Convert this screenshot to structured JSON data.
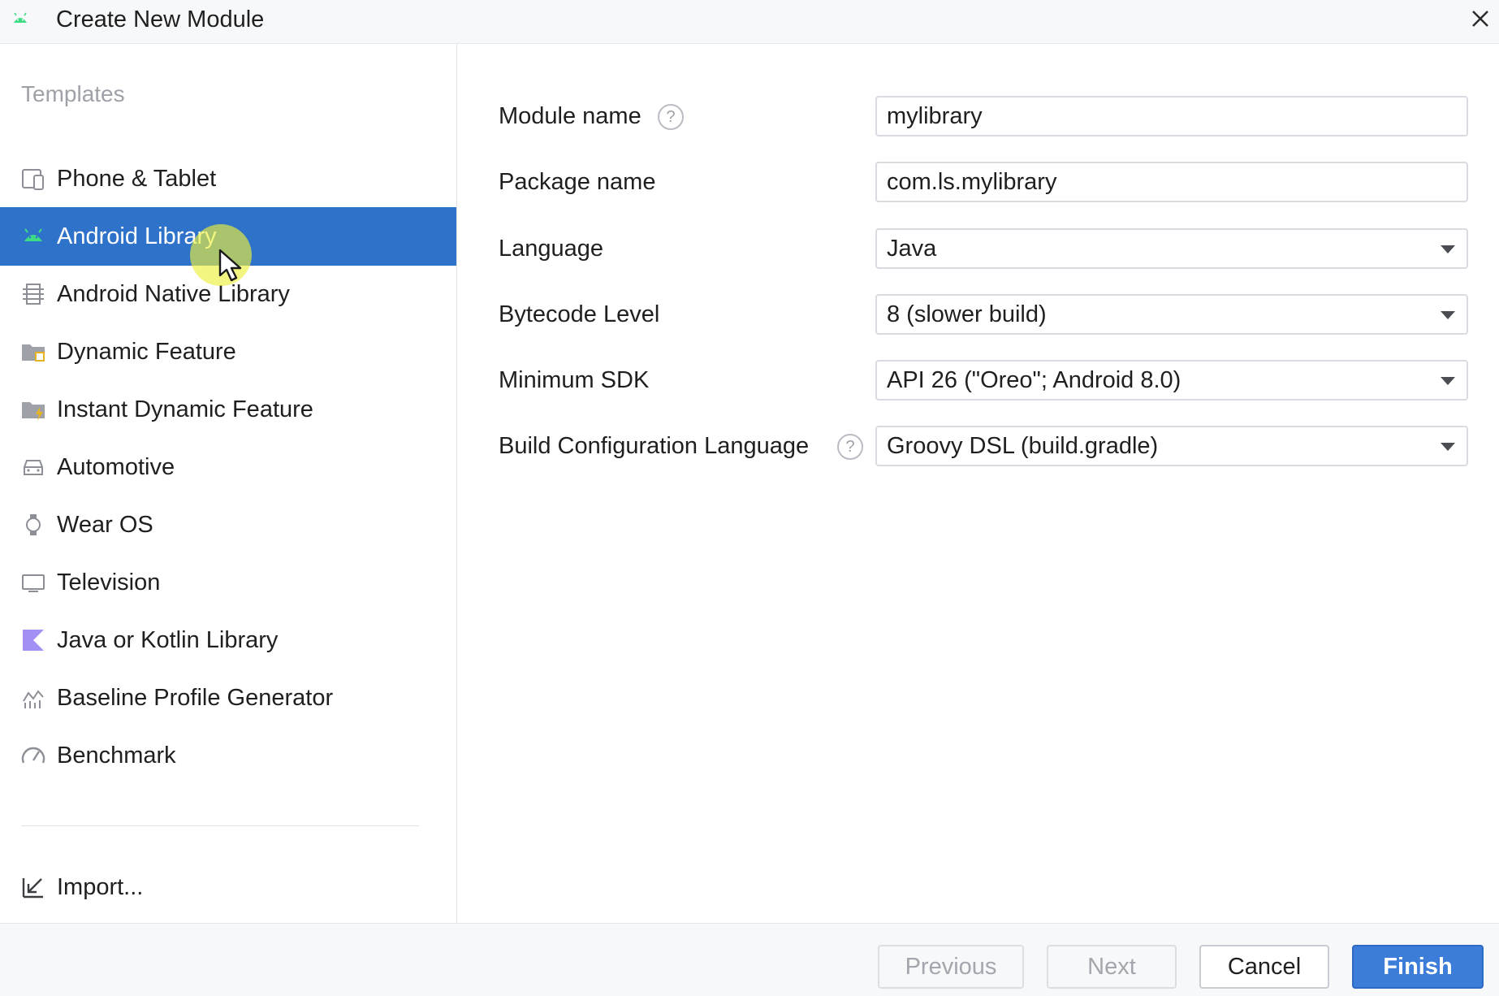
{
  "window": {
    "title": "Create New Module"
  },
  "sidebar": {
    "heading": "Templates",
    "items": [
      {
        "label": "Phone & Tablet",
        "icon": "phone-tablet-icon"
      },
      {
        "label": "Android Library",
        "icon": "android-icon",
        "selected": true
      },
      {
        "label": "Android Native Library",
        "icon": "native-library-icon"
      },
      {
        "label": "Dynamic Feature",
        "icon": "dynamic-feature-folder-icon"
      },
      {
        "label": "Instant Dynamic Feature",
        "icon": "instant-feature-folder-icon"
      },
      {
        "label": "Automotive",
        "icon": "car-icon"
      },
      {
        "label": "Wear OS",
        "icon": "watch-icon"
      },
      {
        "label": "Television",
        "icon": "tv-icon"
      },
      {
        "label": "Java or Kotlin Library",
        "icon": "kotlin-icon"
      },
      {
        "label": "Baseline Profile Generator",
        "icon": "chart-icon"
      },
      {
        "label": "Benchmark",
        "icon": "gauge-icon"
      }
    ],
    "import_label": "Import..."
  },
  "form": {
    "module_name": {
      "label": "Module name",
      "value": "mylibrary"
    },
    "package_name": {
      "label": "Package name",
      "value": "com.ls.mylibrary"
    },
    "language": {
      "label": "Language",
      "value": "Java"
    },
    "bytecode_level": {
      "label": "Bytecode Level",
      "value": "8 (slower build)"
    },
    "minimum_sdk": {
      "label": "Minimum SDK",
      "value": "API 26 (\"Oreo\"; Android 8.0)"
    },
    "build_config_language": {
      "label": "Build Configuration Language",
      "value": "Groovy DSL (build.gradle)"
    }
  },
  "help_glyph": "?",
  "footer": {
    "previous": "Previous",
    "next": "Next",
    "cancel": "Cancel",
    "finish": "Finish"
  },
  "colors": {
    "selection": "#2f72c9",
    "primary_button": "#3b7dd8",
    "android_green": "#3ddc84"
  }
}
